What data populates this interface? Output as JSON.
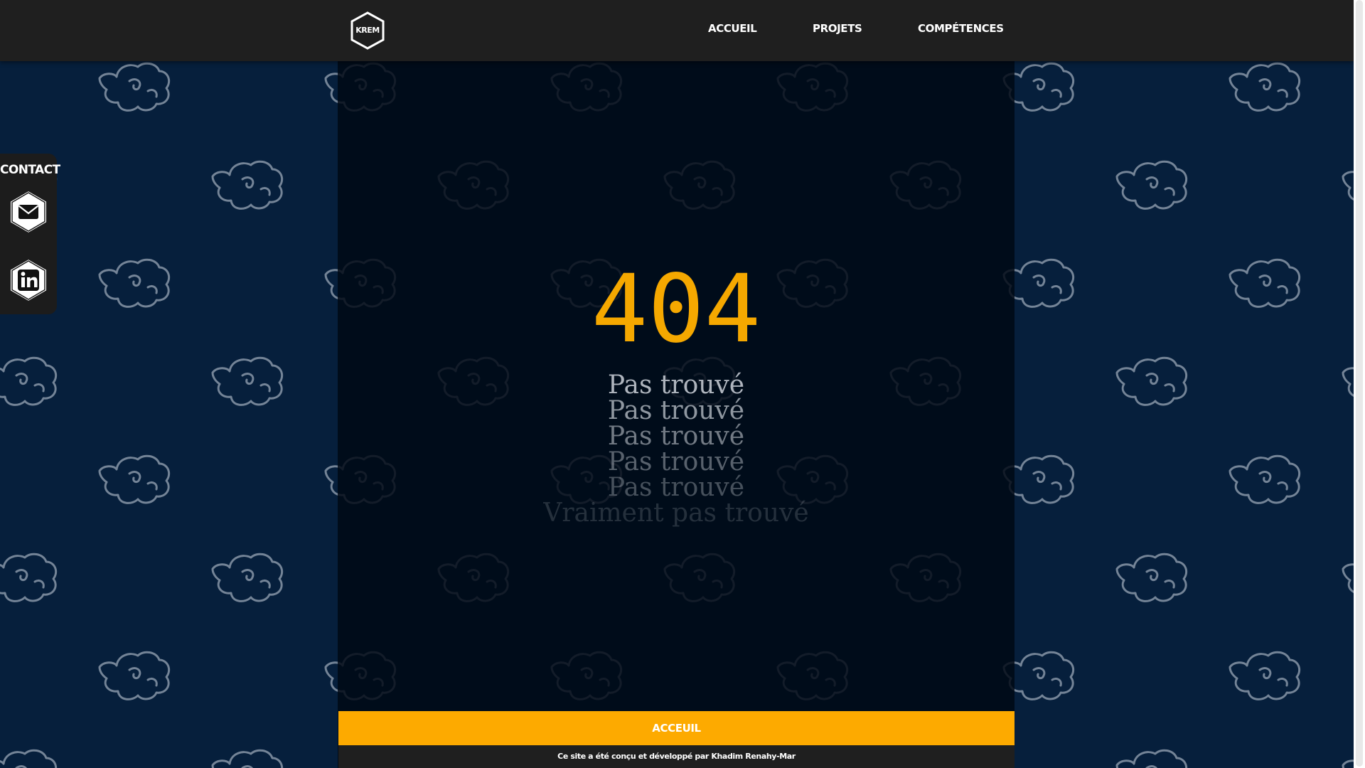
{
  "header": {
    "logo_text": "KREM",
    "nav": [
      {
        "label": "ACCUEIL"
      },
      {
        "label": "PROJETS"
      },
      {
        "label": "COMPÉTENCES"
      }
    ]
  },
  "contact": {
    "title": "CONTACT",
    "icons": [
      "mail-icon",
      "linkedin-icon"
    ]
  },
  "error": {
    "code": "404",
    "lines": [
      "Pas trouvé",
      "Pas trouvé",
      "Pas trouvé",
      "Pas trouvé",
      "Pas trouvé",
      "Vraiment pas trouvé"
    ]
  },
  "bottom_button": {
    "label": "ACCEUIL"
  },
  "footer": {
    "text": "Ce site a été conçu et développé par Khadim Renahy-Mar"
  },
  "colors": {
    "accent": "#fdaa00",
    "code": "#f5a800",
    "background": "#061f3c",
    "header": "#1f1f1f"
  }
}
